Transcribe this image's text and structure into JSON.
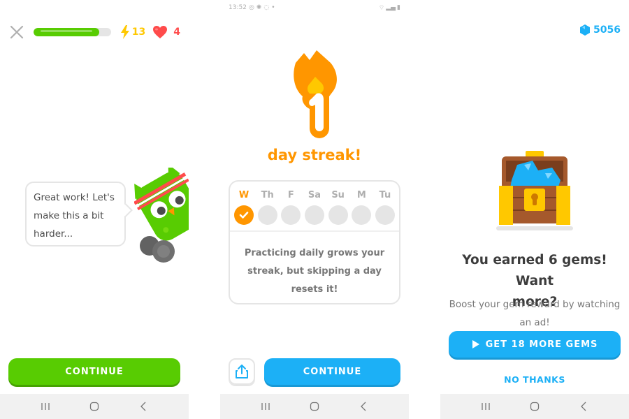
{
  "screen1": {
    "energy_count": "13",
    "hearts_count": "4",
    "lesson_progress_percent": 85,
    "speech_lines": [
      "Great work! Let's",
      "make this a bit",
      "harder..."
    ],
    "continue_label": "CONTINUE",
    "icons": {
      "close": "close-icon",
      "energy": "lightning-icon",
      "hearts": "heart-icon"
    }
  },
  "screen2": {
    "status_bar": {
      "time": "13:52",
      "left_icons": [
        "alarm-icon",
        "settings-icon",
        "whatsapp-icon",
        "dot-icon"
      ],
      "right_icons": [
        "wifi-icon",
        "signal-icon",
        "battery-icon"
      ]
    },
    "streak_number": "1",
    "streak_title": "day streak!",
    "days": [
      {
        "label": "W",
        "done": true
      },
      {
        "label": "Th",
        "done": false
      },
      {
        "label": "F",
        "done": false
      },
      {
        "label": "Sa",
        "done": false
      },
      {
        "label": "Su",
        "done": false
      },
      {
        "label": "M",
        "done": false
      },
      {
        "label": "Tu",
        "done": false
      }
    ],
    "message_lines": [
      "Practicing daily grows your",
      "streak, but skipping a day",
      "resets it!"
    ],
    "continue_label": "CONTINUE",
    "share_icon": "share-icon"
  },
  "screen3": {
    "gems_total": "5056",
    "title_lines": [
      "You earned 6 gems! Want",
      "more?"
    ],
    "subtitle_lines": [
      "Boost your gem reward by watching",
      "an ad!"
    ],
    "get_gems_label": "GET 18 MORE GEMS",
    "no_thanks_label": "NO THANKS"
  },
  "colors": {
    "green": "#58cc02",
    "blue": "#1cb0f6",
    "orange": "#ff9600",
    "red": "#ff4b4b",
    "yellow": "#ffc800"
  },
  "navbar": {
    "icons": [
      "recent-apps-icon",
      "home-icon",
      "back-icon"
    ]
  }
}
